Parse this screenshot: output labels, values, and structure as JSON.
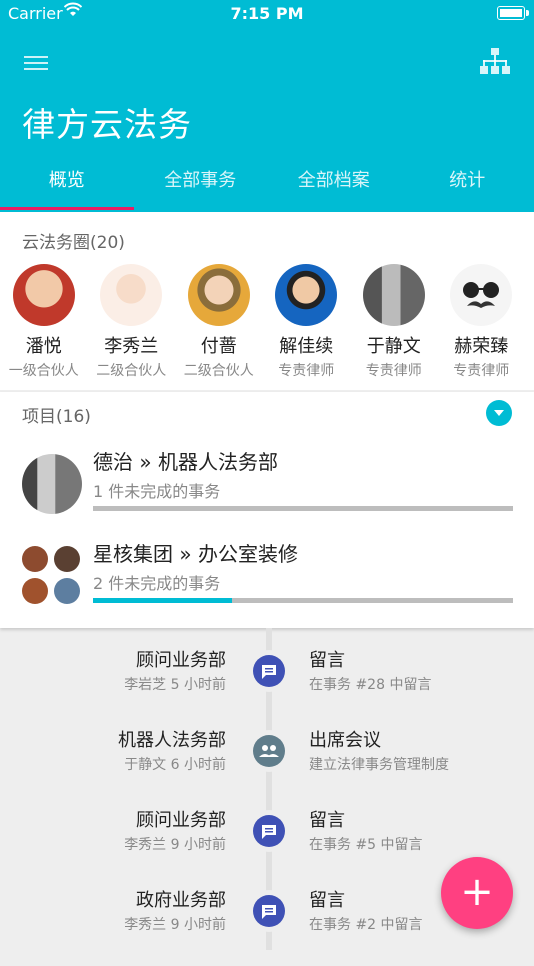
{
  "status_bar": {
    "carrier": "Carrier",
    "time": "7:15 PM"
  },
  "app": {
    "title": "律方云法务"
  },
  "tabs": [
    {
      "label": "概览",
      "active": true
    },
    {
      "label": "全部事务"
    },
    {
      "label": "全部档案"
    },
    {
      "label": "统计"
    }
  ],
  "circle": {
    "heading": "云法务圈(20)",
    "members": [
      {
        "name": "潘悦",
        "role": "一级合伙人",
        "avatar_color": "#c0392b"
      },
      {
        "name": "李秀兰",
        "role": "二级合伙人",
        "avatar_color": "#f3d9c8"
      },
      {
        "name": "付蔷",
        "role": "二级合伙人",
        "avatar_color": "#e6a83a"
      },
      {
        "name": "解佳续",
        "role": "专责律师",
        "avatar_color": "#1565c0"
      },
      {
        "name": "于静文",
        "role": "专责律师",
        "avatar_color": "#888888"
      },
      {
        "name": "赫荣臻",
        "role": "专责律师",
        "avatar_color": "#f5f5f5"
      }
    ]
  },
  "projects": {
    "heading": "项目(16)",
    "items": [
      {
        "title": "德治 » 机器人法务部",
        "subtitle": "1 件未完成的事务",
        "progress": 0
      },
      {
        "title": "星核集团 » 办公室装修",
        "subtitle": "2 件未完成的事务",
        "progress": 0.33
      }
    ]
  },
  "timeline": [
    {
      "dept": "顾问业务部",
      "who": "李岩芝 5 小时前",
      "action": "留言",
      "desc": "在事务 #28 中留言",
      "icon": "message-icon",
      "color": "#3f51b5"
    },
    {
      "dept": "机器人法务部",
      "who": "于静文 6 小时前",
      "action": "出席会议",
      "desc": "建立法律事务管理制度",
      "icon": "group-icon",
      "color": "#607d8b"
    },
    {
      "dept": "顾问业务部",
      "who": "李秀兰 9 小时前",
      "action": "留言",
      "desc": "在事务 #5 中留言",
      "icon": "message-icon",
      "color": "#3f51b5"
    },
    {
      "dept": "政府业务部",
      "who": "李秀兰 9 小时前",
      "action": "留言",
      "desc": "在事务 #2 中留言",
      "icon": "message-icon",
      "color": "#3f51b5"
    }
  ],
  "fab": {
    "label": "+"
  },
  "colors": {
    "primary": "#00bcd4",
    "accent": "#ff4081",
    "tab_indicator": "#e91e63"
  }
}
